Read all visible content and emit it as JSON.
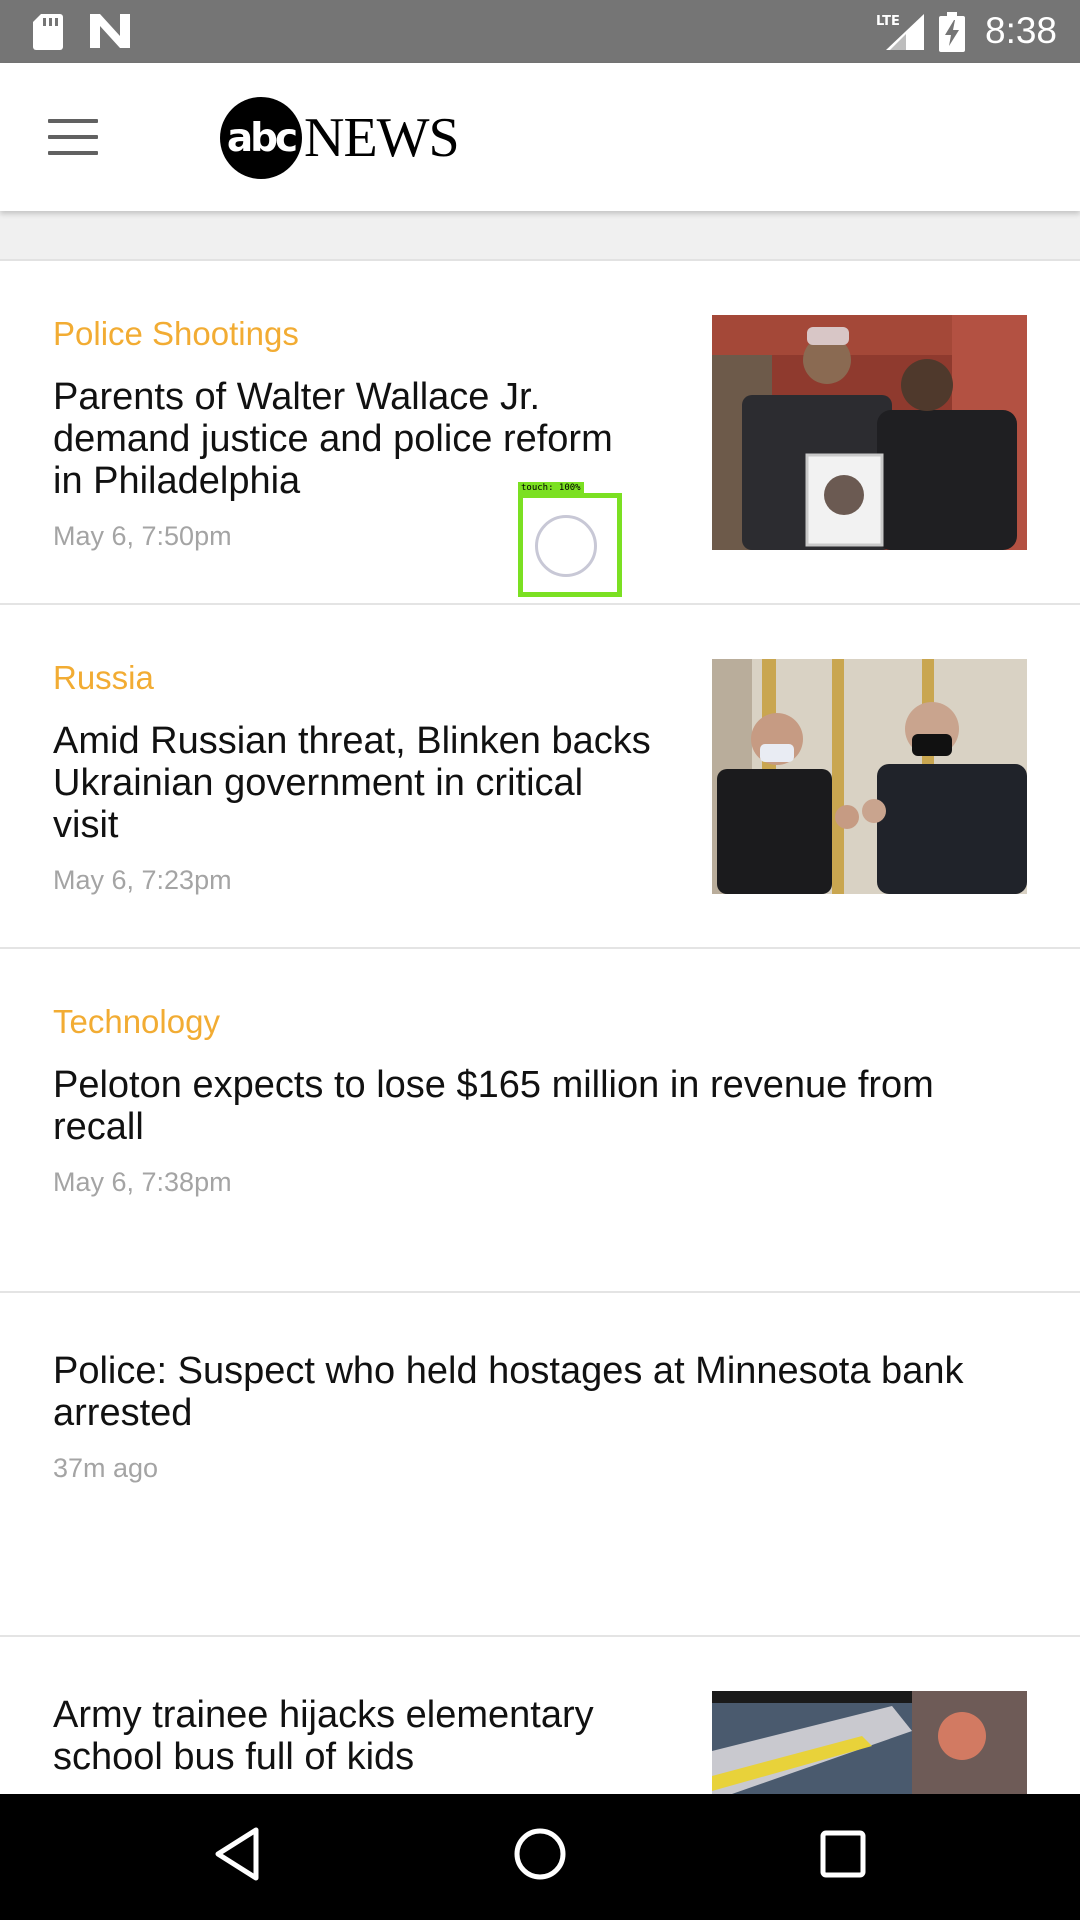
{
  "status_bar": {
    "time": "8:38",
    "network_label": "LTE",
    "icons": [
      "sd-card-icon",
      "n-notification-icon",
      "lte-signal-icon",
      "battery-charging-icon"
    ]
  },
  "header": {
    "logo_circle_text": "abc",
    "logo_word": "NEWS",
    "menu_icon": "hamburger-menu-icon"
  },
  "articles": [
    {
      "category": "Police Shootings",
      "headline": "Parents of Walter Wallace Jr. demand justice and police reform in Philadelphia",
      "time": "May 6, 7:50pm",
      "has_thumbnail": true
    },
    {
      "category": "Russia",
      "headline": "Amid Russian threat, Blinken backs Ukrainian government in critical visit",
      "time": "May 6, 7:23pm",
      "has_thumbnail": true
    },
    {
      "category": "Technology",
      "headline": "Peloton expects to lose $165 million in revenue from recall",
      "time": "May 6, 7:38pm",
      "has_thumbnail": false
    },
    {
      "category": "",
      "headline": "Police: Suspect who held hostages at Minnesota bank arrested",
      "time": "37m ago",
      "has_thumbnail": false
    },
    {
      "category": "",
      "headline": "Army trainee hijacks elementary school bus full of kids",
      "time": "",
      "has_thumbnail": true
    }
  ],
  "touch_indicator": {
    "label": "touch: 100%"
  },
  "nav_bar": {
    "icons": [
      "back-icon",
      "home-icon",
      "recents-icon"
    ]
  },
  "colors": {
    "category_accent": "#f2ac33",
    "status_bar": "#757575",
    "touch_box": "#7be022"
  }
}
